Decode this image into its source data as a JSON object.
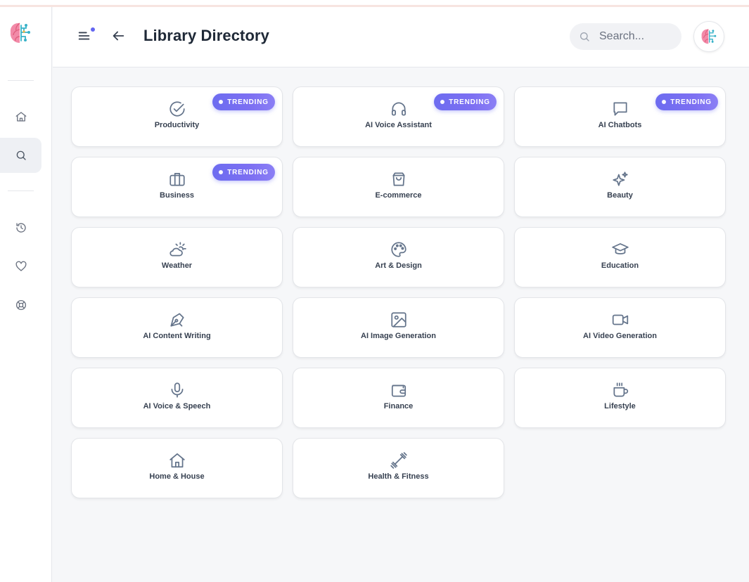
{
  "header": {
    "title": "Library Directory",
    "search_placeholder": "Search..."
  },
  "sidebar": {
    "items": [
      {
        "name": "home",
        "icon": "home-icon",
        "active": false
      },
      {
        "name": "search",
        "icon": "search-icon",
        "active": true
      },
      {
        "name": "history",
        "icon": "history-icon",
        "active": false
      },
      {
        "name": "favorites",
        "icon": "heart-icon",
        "active": false
      },
      {
        "name": "support",
        "icon": "lifebuoy-icon",
        "active": false
      }
    ]
  },
  "badge_label": "TRENDING",
  "colors": {
    "accent": "#6d6cf0",
    "icon": "#64748b"
  },
  "categories": [
    {
      "label": "Productivity",
      "icon": "check-circle-icon",
      "trending": true
    },
    {
      "label": "AI Voice Assistant",
      "icon": "headphones-icon",
      "trending": true
    },
    {
      "label": "AI Chatbots",
      "icon": "chat-bubble-icon",
      "trending": true
    },
    {
      "label": "Business",
      "icon": "briefcase-icon",
      "trending": true
    },
    {
      "label": "E-commerce",
      "icon": "shopping-bag-icon",
      "trending": false
    },
    {
      "label": "Beauty",
      "icon": "sparkles-icon",
      "trending": false
    },
    {
      "label": "Weather",
      "icon": "cloud-sun-icon",
      "trending": false
    },
    {
      "label": "Art & Design",
      "icon": "palette-icon",
      "trending": false
    },
    {
      "label": "Education",
      "icon": "graduation-cap-icon",
      "trending": false
    },
    {
      "label": "AI Content Writing",
      "icon": "pen-tool-icon",
      "trending": false
    },
    {
      "label": "AI Image Generation",
      "icon": "image-icon",
      "trending": false
    },
    {
      "label": "AI Video Generation",
      "icon": "video-icon",
      "trending": false
    },
    {
      "label": "AI Voice & Speech",
      "icon": "microphone-icon",
      "trending": false
    },
    {
      "label": "Finance",
      "icon": "wallet-icon",
      "trending": false
    },
    {
      "label": "Lifestyle",
      "icon": "coffee-cup-icon",
      "trending": false
    },
    {
      "label": "Home & House",
      "icon": "house-icon",
      "trending": false
    },
    {
      "label": "Health & Fitness",
      "icon": "dumbbell-icon",
      "trending": false
    }
  ]
}
